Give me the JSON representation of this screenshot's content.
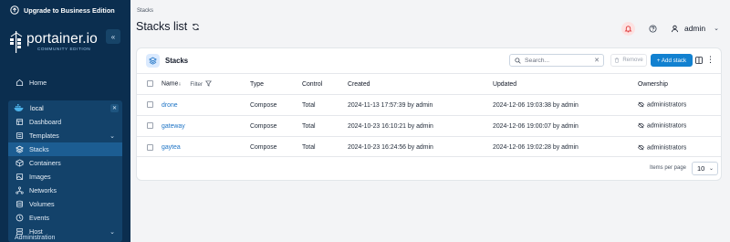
{
  "sidebar": {
    "upgrade_label": "Upgrade to Business Edition",
    "brand_name": "portainer.io",
    "brand_edition": "COMMUNITY EDITION",
    "home_label": "Home",
    "environment_name": "local",
    "items": [
      {
        "label": "Dashboard",
        "icon": "dashboard-icon"
      },
      {
        "label": "Templates",
        "icon": "templates-icon"
      },
      {
        "label": "Stacks",
        "icon": "stacks-icon"
      },
      {
        "label": "Containers",
        "icon": "containers-icon"
      },
      {
        "label": "Images",
        "icon": "images-icon"
      },
      {
        "label": "Networks",
        "icon": "networks-icon"
      },
      {
        "label": "Volumes",
        "icon": "volumes-icon"
      },
      {
        "label": "Events",
        "icon": "events-icon"
      },
      {
        "label": "Host",
        "icon": "host-icon"
      }
    ],
    "administration_label": "Administration"
  },
  "header": {
    "breadcrumb": "Stacks",
    "title": "Stacks list",
    "user": "admin"
  },
  "card": {
    "title": "Stacks",
    "search_placeholder": "Search...",
    "remove_label": "Remove",
    "add_label": "+ Add stack"
  },
  "table": {
    "columns": {
      "name": "Name",
      "filter": "Filter",
      "type": "Type",
      "control": "Control",
      "created": "Created",
      "updated": "Updated",
      "ownership": "Ownership"
    },
    "rows": [
      {
        "name": "drone",
        "type": "Compose",
        "control": "Total",
        "created": "2024-11-13 17:57:39 by admin",
        "updated": "2024-12-06 19:03:38 by admin",
        "ownership": "administrators"
      },
      {
        "name": "gateway",
        "type": "Compose",
        "control": "Total",
        "created": "2024-10-23 16:10:21 by admin",
        "updated": "2024-12-06 19:00:07 by admin",
        "ownership": "administrators"
      },
      {
        "name": "gaytea",
        "type": "Compose",
        "control": "Total",
        "created": "2024-10-23 16:24:56 by admin",
        "updated": "2024-12-06 19:02:28 by admin",
        "ownership": "administrators"
      }
    ]
  },
  "footer": {
    "items_per_page_label": "Items per page",
    "items_per_page_value": "10"
  },
  "colors": {
    "sidebar_bg": "#0b2e4f",
    "sidebar_active": "#1c5d92",
    "primary": "#1281d0",
    "link": "#1d73c5"
  }
}
